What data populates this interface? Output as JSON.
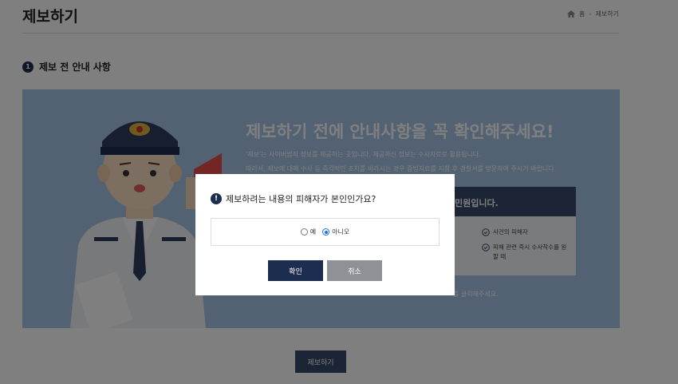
{
  "header": {
    "title": "제보하기",
    "breadcrumb": {
      "home": "홈",
      "separator": "›",
      "current": "제보하기"
    }
  },
  "section": {
    "step_number": "1",
    "title": "제보 전 안내 사항"
  },
  "banner": {
    "headline": "제보하기 전에 안내사항을 꼭 확인해주세요!",
    "lines": [
      "'제보'는 사이버범죄 정보를 제공하는 곳입니다. 제공하신 정보는 수사자료로 활용됩니다.",
      "따라서, 제보에 대해 수사 등 즉각적인 조치를 바라시는 경우 증빙자료를 지참 후 경찰서를 방문하여 주시기 바랍니다."
    ],
    "card": {
      "heading": "민원입니다.",
      "items": [
        "사건의 피해자",
        "피해 관련 즉시 수사착수를 원할 때"
      ]
    },
    "footer_text": "를 클릭해주세요."
  },
  "page_submit_label": "제보하기",
  "modal": {
    "question": "제보하려는 내용의 피해자가 본인인가요?",
    "options": [
      {
        "label": "예",
        "checked": false
      },
      {
        "label": "아니오",
        "checked": true
      }
    ],
    "confirm_label": "확인",
    "cancel_label": "취소"
  },
  "colors": {
    "navy": "#1d2d4f",
    "banner_bg": "#a4c4e6",
    "card_header": "#384a6b",
    "cancel_gray": "#8e9297",
    "radio_selected": "#1a73e8"
  },
  "icons": [
    "home-icon",
    "check-circle-icon",
    "exclamation-icon"
  ]
}
